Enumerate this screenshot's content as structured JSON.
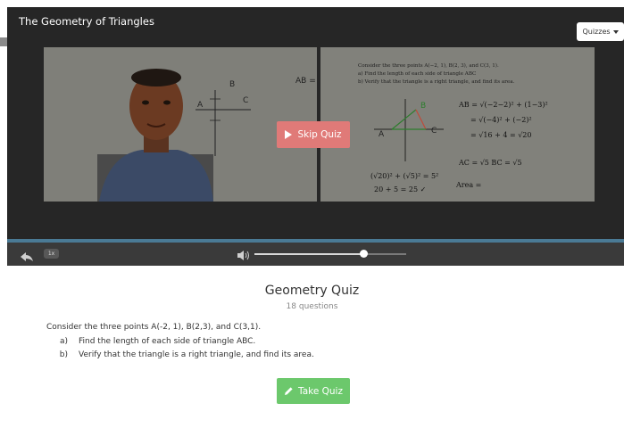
{
  "video": {
    "title": "The Geometry of Triangles",
    "quizzes_label": "Quizzes",
    "skip_label": "Skip Quiz",
    "speed_label": "1x",
    "volume_level": 0.72
  },
  "slide": {
    "intro": "Consider the three points A(−2, 1), B(2, 3), and C(3, 1).",
    "part_a": "a)   Find the length of each side of triangle ABC",
    "part_b": "b)   Verify that the triangle is a right triangle, and find its area.",
    "left_point_a": "A",
    "left_point_b": "B",
    "left_point_c": "C",
    "left_ab": "AB =",
    "right_point_a": "A",
    "right_point_b": "B",
    "right_point_c": "C",
    "eq1": "AB = √(−2−2)² + (1−3)²",
    "eq2": "= √(−4)² + (−2)²",
    "eq3": "= √16 + 4  = √20",
    "eq4": "AC = √5   BC = √5",
    "eq5": "(√20)² + (√5)² = 5²",
    "eq6": "20 + 5 = 25 ✓",
    "eq7": "Area ="
  },
  "quiz": {
    "title": "Geometry Quiz",
    "count": "18 questions",
    "question": "Consider the three points A(-2, 1), B(2,3), and C(3,1).",
    "parts": [
      {
        "letter": "a)",
        "text": "Find the length of each side of triangle ABC."
      },
      {
        "letter": "b)",
        "text": "Verify that the triangle is a right triangle, and find its area."
      }
    ],
    "take_label": "Take Quiz"
  },
  "colors": {
    "skip": "#e07a78",
    "take": "#6cc86c",
    "player": "#262626",
    "progress": "#4a7a95"
  }
}
